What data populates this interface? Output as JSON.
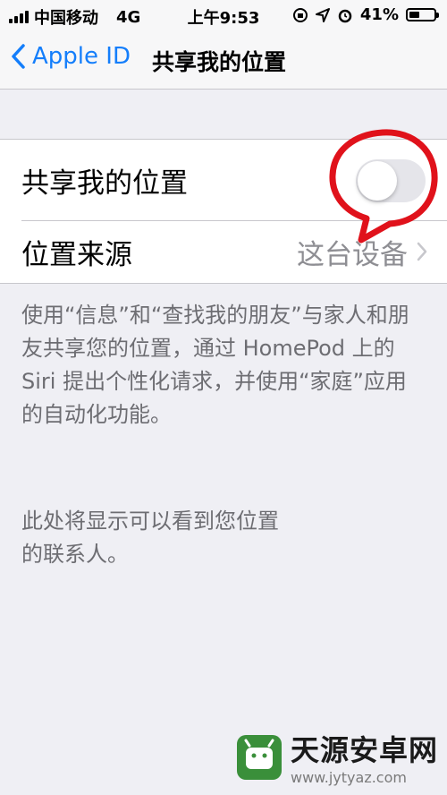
{
  "status_bar": {
    "carrier": "中国移动",
    "network": "4G",
    "time": "上午9:53",
    "battery_percent": "41%",
    "battery_level": 0.41
  },
  "nav": {
    "back_label": "Apple ID",
    "title": "共享我的位置"
  },
  "settings": {
    "share_location_label": "共享我的位置",
    "share_location_on": false,
    "location_source_label": "位置来源",
    "location_source_value": "这台设备"
  },
  "footer": {
    "description": "使用“信息”和“查找我的朋友”与家人和朋友共享您的位置，通过 HomePod 上的 Siri 提出个性化请求，并使用“家庭”应用的自动化功能。",
    "contacts_note_line1": "此处将显示可以看到您位置",
    "contacts_note_line2": "的联系人。"
  },
  "watermark": {
    "title": "天源安卓网",
    "url": "www.jytyaz.com"
  },
  "colors": {
    "accent": "#147efb",
    "highlight": "#e0121b",
    "toggle_off": "#e5e5ea"
  },
  "icons": [
    "signal-icon",
    "location-arrow-icon",
    "alarm-icon",
    "battery-icon",
    "back-chevron-icon",
    "chevron-right-icon"
  ]
}
